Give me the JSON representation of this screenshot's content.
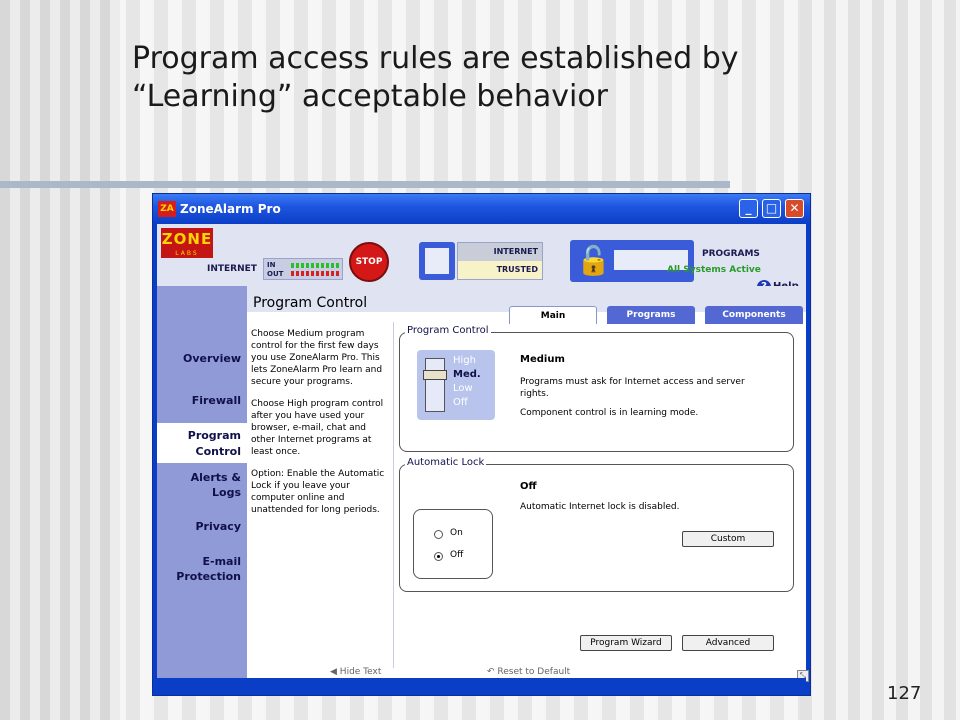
{
  "slide": {
    "title_line1": "Program access rules are established by",
    "title_line2": "“Learning” acceptable behavior",
    "page_number": "127"
  },
  "window": {
    "title": "ZoneAlarm Pro",
    "logo_text": "ZA",
    "controls": {
      "minimize": "_",
      "maximize": "□",
      "close": "✕"
    }
  },
  "header": {
    "brand": "ZONE",
    "brand_sub": "LABS",
    "internet_label": "INTERNET",
    "meter_in": "IN",
    "meter_out": "OUT",
    "stop_label": "STOP",
    "zone_internet": "INTERNET",
    "zone_trusted": "TRUSTED",
    "programs_label": "PROGRAMS",
    "status": "All Systems Active",
    "help": "Help",
    "help_icon": "?"
  },
  "sidebar": {
    "items": [
      {
        "label": "Overview"
      },
      {
        "label": "Firewall"
      },
      {
        "label": "Program Control",
        "active": true
      },
      {
        "label": "Alerts & Logs"
      },
      {
        "label": "Privacy"
      },
      {
        "label": "E-mail Protection"
      }
    ]
  },
  "page": {
    "title": "Program Control",
    "tabs": [
      "Main",
      "Programs",
      "Components"
    ],
    "active_tab": "Main"
  },
  "description": {
    "para1": "Choose Medium program control for the first few days you use ZoneAlarm Pro. This lets ZoneAlarm Pro learn and secure your programs.",
    "para2": "Choose High program control after you have used your browser, e-mail, chat and other Internet programs at least once.",
    "para3": "Option: Enable the Automatic Lock if you leave your computer online and unattended for long periods."
  },
  "program_control": {
    "group_label": "Program Control",
    "levels": [
      "High",
      "Med.",
      "Low",
      "Off"
    ],
    "selected_level": "Med.",
    "title": "Medium",
    "text1": "Programs must ask for Internet access and server rights.",
    "text2": "Component control is in learning mode."
  },
  "automatic_lock": {
    "group_label": "Automatic Lock",
    "options": [
      "On",
      "Off"
    ],
    "selected": "Off",
    "title": "Off",
    "text": "Automatic Internet lock is disabled.",
    "custom_button": "Custom"
  },
  "footer": {
    "hide_text": "Hide Text",
    "reset": "Reset to Default",
    "wizard_button": "Program Wizard",
    "advanced_button": "Advanced"
  }
}
